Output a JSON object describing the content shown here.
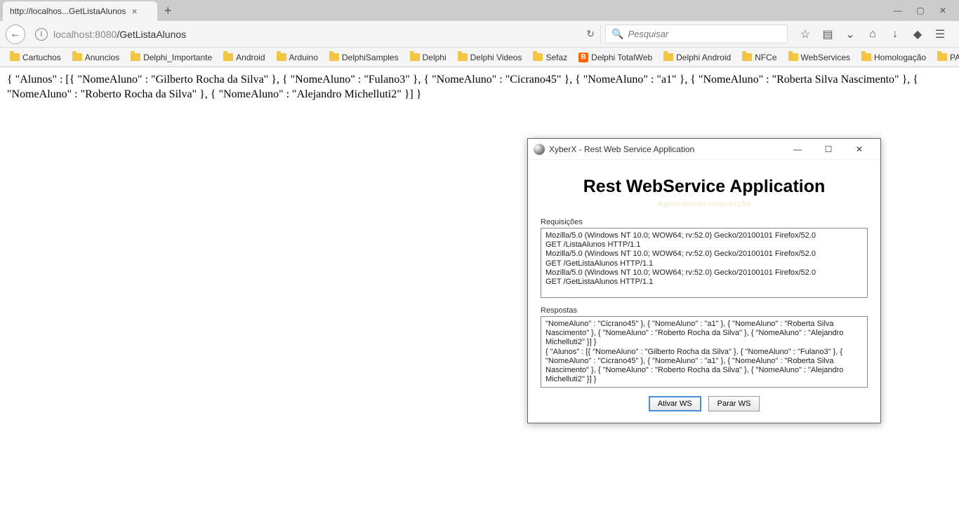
{
  "browser": {
    "tab_title": "http://localhos...GetListaAlunos",
    "url_host": "localhost",
    "url_port": ":8080",
    "url_path": "/GetListaAlunos",
    "search_placeholder": "Pesquisar",
    "bookmarks": [
      {
        "label": "Cartuchos",
        "icon": "folder"
      },
      {
        "label": "Anuncios",
        "icon": "folder"
      },
      {
        "label": "Delphi_Importante",
        "icon": "folder"
      },
      {
        "label": "Android",
        "icon": "folder"
      },
      {
        "label": "Arduino",
        "icon": "folder"
      },
      {
        "label": "DelphiSamples",
        "icon": "folder"
      },
      {
        "label": "Delphi",
        "icon": "folder"
      },
      {
        "label": "Delphi Videos",
        "icon": "folder"
      },
      {
        "label": "Sefaz",
        "icon": "folder"
      },
      {
        "label": "Delphi TotalWeb",
        "icon": "blogger"
      },
      {
        "label": "Delphi Android",
        "icon": "folder"
      },
      {
        "label": "NFCe",
        "icon": "folder"
      },
      {
        "label": "WebServices",
        "icon": "folder"
      },
      {
        "label": "Homologação",
        "icon": "folder"
      },
      {
        "label": "PAF-ECF",
        "icon": "folder"
      }
    ]
  },
  "page_json_text": "{ \"Alunos\" : [{ \"NomeAluno\" : \"Gilberto Rocha da Silva\" }, { \"NomeAluno\" : \"Fulano3\" }, { \"NomeAluno\" : \"Cicrano45\" }, { \"NomeAluno\" : \"a1\" }, { \"NomeAluno\" : \"Roberta Silva Nascimento\" }, { \"NomeAluno\" : \"Roberto Rocha da Silva\" }, { \"NomeAluno\" : \"Alejandro Michelluti2\" }] }",
  "app": {
    "title": "XyberX - Rest Web Service Application",
    "heading": "Rest WebService Application",
    "subheading": "Aguardando requisição",
    "requests_label": "Requisições",
    "requests_log": "Mozilla/5.0 (Windows NT 10.0; WOW64; rv:52.0) Gecko/20100101 Firefox/52.0\nGET /ListaAlunos HTTP/1.1\nMozilla/5.0 (Windows NT 10.0; WOW64; rv:52.0) Gecko/20100101 Firefox/52.0\nGET /GetListaAlunos HTTP/1.1\nMozilla/5.0 (Windows NT 10.0; WOW64; rv:52.0) Gecko/20100101 Firefox/52.0\nGET /GetListaAlunos HTTP/1.1",
    "responses_label": "Respostas",
    "responses_log": "\"NomeAluno\" : \"Cicrano45\" }, { \"NomeAluno\" : \"a1\" }, { \"NomeAluno\" : \"Roberta Silva Nascimento\" }, { \"NomeAluno\" : \"Roberto Rocha da Silva\" }, { \"NomeAluno\" : \"Alejandro Michelluti2\" }] }\n{ \"Alunos\" : [{ \"NomeAluno\" : \"Gilberto Rocha da Silva\" }, { \"NomeAluno\" : \"Fulano3\" }, { \"NomeAluno\" : \"Cicrano45\" }, { \"NomeAluno\" : \"a1\" }, { \"NomeAluno\" : \"Roberta Silva Nascimento\" }, { \"NomeAluno\" : \"Roberto Rocha da Silva\" }, { \"NomeAluno\" : \"Alejandro Michelluti2\" }] }",
    "btn_activate": "Ativar WS",
    "btn_stop": "Parar WS"
  }
}
